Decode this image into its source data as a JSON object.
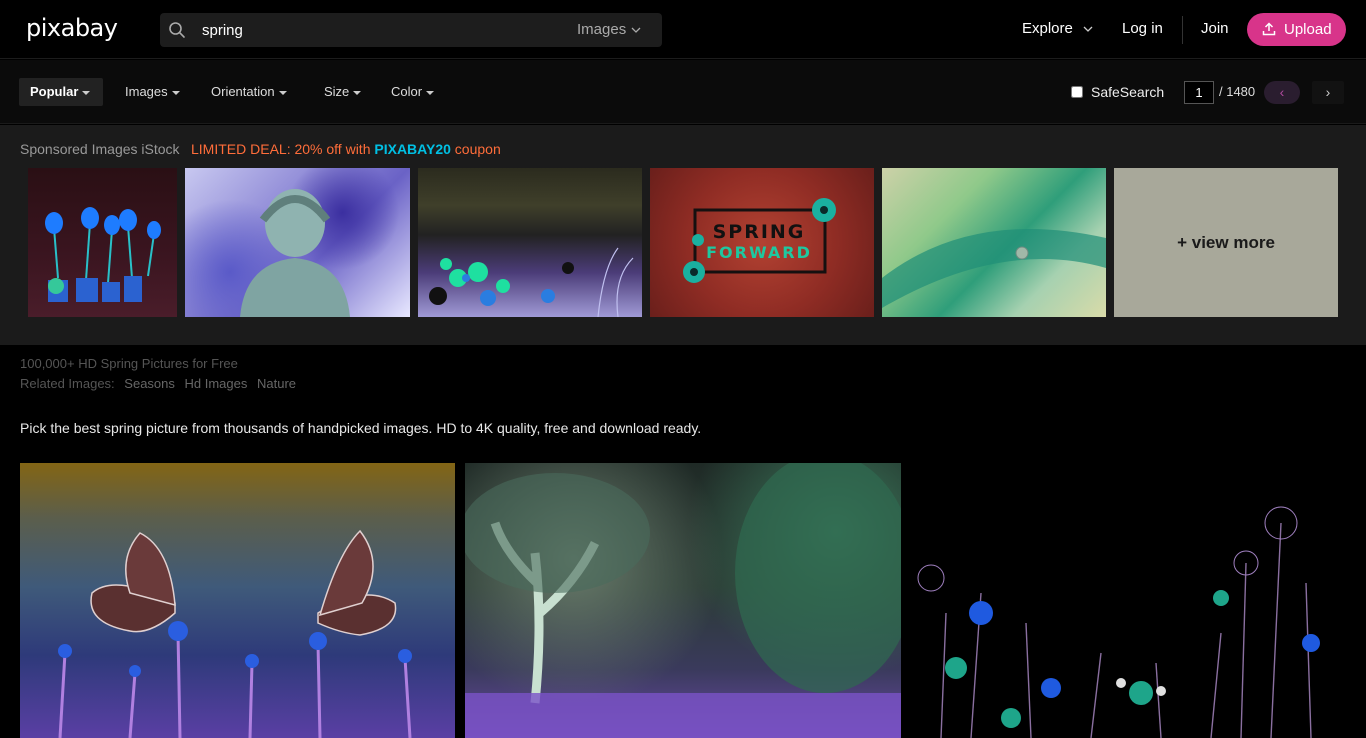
{
  "header": {
    "logo": "pixabay",
    "search": {
      "value": "spring",
      "type_label": "Images"
    },
    "nav": {
      "explore": "Explore",
      "login": "Log in",
      "join": "Join",
      "upload": "Upload"
    }
  },
  "filters": {
    "popular": "Popular",
    "images": "Images",
    "orientation": "Orientation",
    "size": "Size",
    "color": "Color",
    "safesearch": "SafeSearch",
    "page": "1",
    "total_pages": "/ 1480",
    "prev": "‹",
    "next": "›"
  },
  "sponsored": {
    "label": "Sponsored Images iStock",
    "deal_prefix": "LIMITED DEAL: 20% off with ",
    "deal_code": "PIXABAY20",
    "deal_suffix": " coupon",
    "thumb4_line1": "SPRING",
    "thumb4_line2": "FORWARD",
    "view_more": "+ view more"
  },
  "info": {
    "heading": "100,000+ HD Spring Pictures for Free",
    "related_label": "Related Images:",
    "related": [
      "Seasons",
      "Hd Images",
      "Nature"
    ],
    "description": "Pick the best spring picture from thousands of handpicked images. HD to 4K quality, free and download ready."
  },
  "colors": {
    "accent": "#d8348a",
    "deal": "#ff6d3a",
    "coupon": "#00c0e4"
  }
}
